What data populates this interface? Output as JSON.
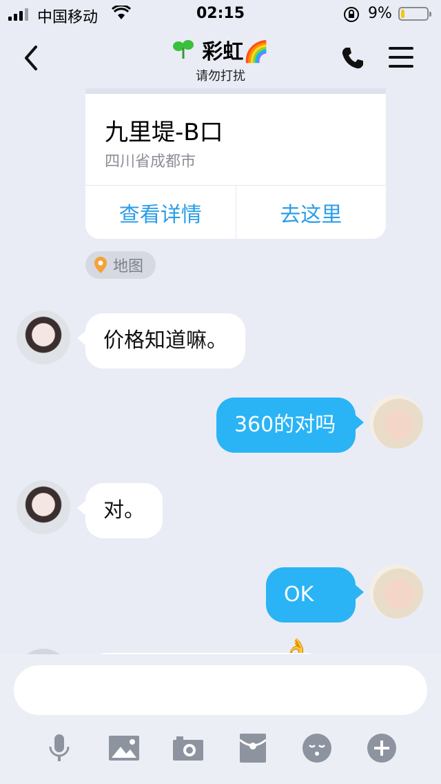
{
  "status": {
    "carrier": "中国移动",
    "time": "02:15",
    "battery_percent": "9%",
    "battery_level": 0.09
  },
  "header": {
    "title": "彩虹🌈",
    "subtitle": "请勿打扰"
  },
  "location_card": {
    "name": "九里堤-B口",
    "address": "四川省成都市",
    "actions": [
      "查看详情",
      "去这里"
    ],
    "tag": "地图"
  },
  "messages": [
    {
      "side": "in",
      "text": "价格知道嘛。"
    },
    {
      "side": "out",
      "text": "360的对吗"
    },
    {
      "side": "in",
      "text": "对。"
    },
    {
      "side": "out",
      "text": "OK👌"
    }
  ],
  "input": {
    "placeholder": ""
  },
  "toolbar": {
    "icons": [
      "microphone-icon",
      "image-icon",
      "camera-icon",
      "red-packet-icon",
      "emoji-icon",
      "plus-icon"
    ]
  },
  "colors": {
    "accent": "#2ab4f5",
    "link": "#2a9de8",
    "background": "#e9ecf5"
  }
}
